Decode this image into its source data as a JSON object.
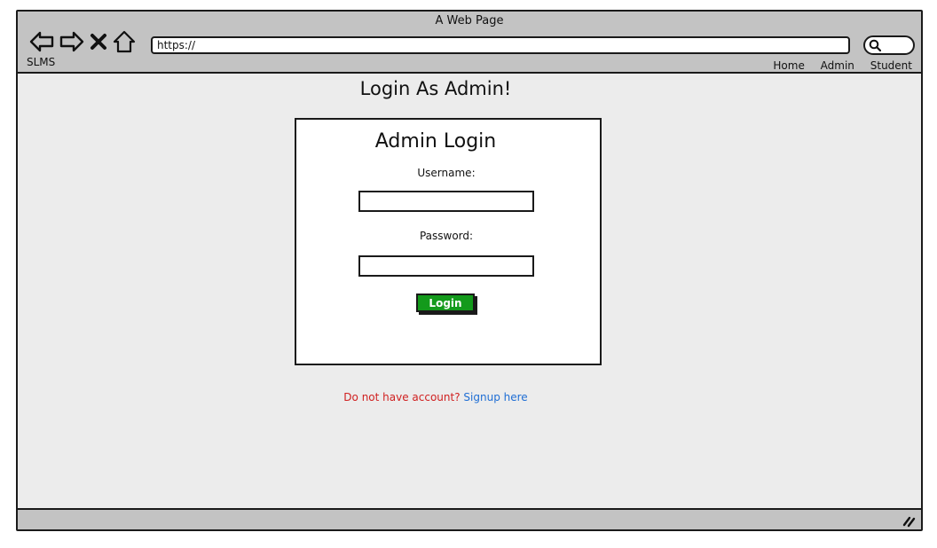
{
  "window": {
    "title": "A Web Page",
    "url": "https://",
    "brand": "SLMS"
  },
  "toolbar": {
    "icons": [
      "back-arrow-icon",
      "forward-arrow-icon",
      "close-x-icon",
      "home-icon",
      "search-icon",
      "resize-grip-icon"
    ]
  },
  "nav": {
    "items": [
      {
        "label": "Home"
      },
      {
        "label": "Admin"
      },
      {
        "label": "Student"
      }
    ]
  },
  "page": {
    "heading": "Login As Admin!"
  },
  "login_form": {
    "title": "Admin Login",
    "username_label": "Username:",
    "username_value": "",
    "password_label": "Password:",
    "password_value": "",
    "submit_label": "Login",
    "submit_color": "#139a1b"
  },
  "signup": {
    "question": "Do not have account?",
    "link_text": "Signup here",
    "question_color": "#d02020",
    "link_color": "#1f6ed4"
  }
}
